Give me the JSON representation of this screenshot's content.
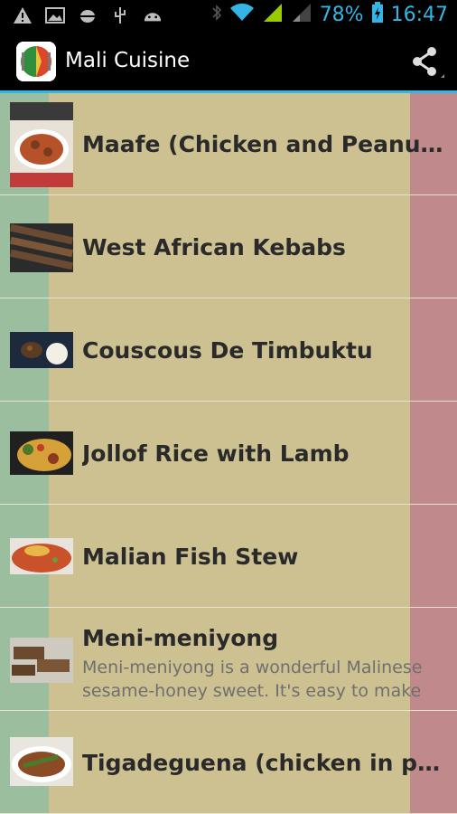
{
  "statusbar": {
    "battery": "78%",
    "time": "16:47",
    "icons": [
      "warning-icon",
      "image-icon",
      "android-debug-icon",
      "usb-icon",
      "android-icon",
      "bluetooth-icon",
      "wifi-icon",
      "signal-icon",
      "signal-icon-2",
      "battery-icon"
    ]
  },
  "actionbar": {
    "title": "Mali Cuisine",
    "share_icon": "share-icon"
  },
  "recipes": [
    {
      "title": "Maafe (Chicken and Peanut St…"
    },
    {
      "title": "West African Kebabs"
    },
    {
      "title": "Couscous De Timbuktu"
    },
    {
      "title": "Jollof Rice with Lamb"
    },
    {
      "title": "Malian Fish Stew"
    },
    {
      "title": "Meni-meniyong",
      "description": "Meni-meniyong is a wonderful Malinese sesame-honey sweet. It's easy to make"
    },
    {
      "title": "Tigadeguena (chicken in pean…"
    }
  ],
  "colors": {
    "accent": "#33b5e5",
    "green_stripe": "#9bbf9e",
    "yellow_stripe": "#cdc191",
    "red_stripe": "#c08a8c"
  }
}
